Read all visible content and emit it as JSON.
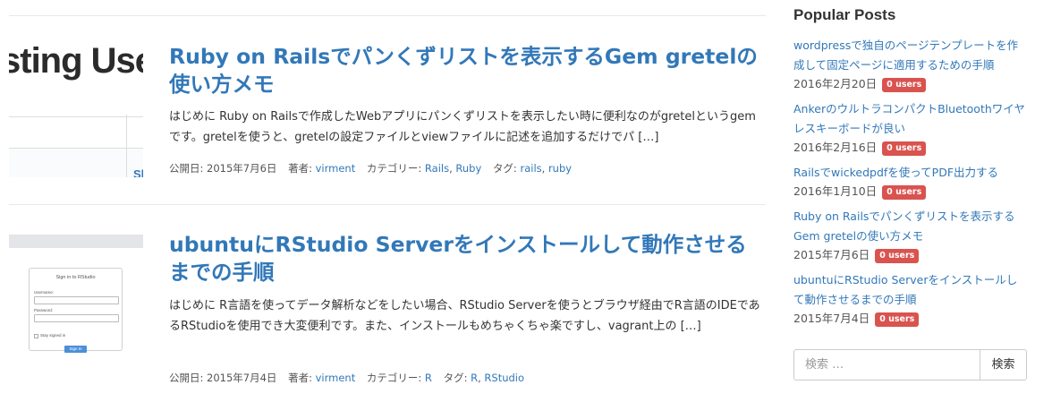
{
  "posts": [
    {
      "thumb_text": "sting User",
      "thumb_link_text": "Sh",
      "title": "Ruby on Railsでパンくずリストを表示するGem gretelの使い方メモ",
      "excerpt": "はじめに Ruby on Railsで作成したWebアプリにパンくずリストを表示したい時に便利なのがgretelというgemです。gretelを使うと、gretelの設定ファイルとviewファイルに記述を追加するだけでパ […]",
      "meta": {
        "date_label": "公開日: 2015年7月6日",
        "author_label": "著者:",
        "author": "virment",
        "category_label": "カテゴリー:",
        "categories": [
          "Rails",
          "Ruby"
        ],
        "tag_label": "タグ:",
        "tags": [
          "rails",
          "ruby"
        ]
      }
    },
    {
      "thumb_form": {
        "title": "Sign in to RStudio",
        "username_label": "Username:",
        "password_label": "Password:",
        "stay_label": "Stay signed in",
        "button": "Sign In"
      },
      "title": "ubuntuにRStudio Serverをインストールして動作させるまでの手順",
      "excerpt": "はじめに R言語を使ってデータ解析などをしたい場合、RStudio Serverを使うとブラウザ経由でR言語のIDEであるRStudioを使用でき大変便利です。また、インストールもめちゃくちゃ楽ですし、vagrant上の […]",
      "meta": {
        "date_label": "公開日: 2015年7月4日",
        "author_label": "著者:",
        "author": "virment",
        "category_label": "カテゴリー:",
        "categories": [
          "R"
        ],
        "tag_label": "タグ:",
        "tags": [
          "R",
          "RStudio"
        ]
      }
    }
  ],
  "sidebar": {
    "title": "Popular Posts",
    "items": [
      {
        "title": "wordpressで独自のページテンプレートを作成して固定ページに適用するための手順",
        "date": "2016年2月20日",
        "badge": "0 users"
      },
      {
        "title": "AnkerのウルトラコンパクトBluetoothワイヤレスキーボードが良い",
        "date": "2016年2月16日",
        "badge": "0 users"
      },
      {
        "title": "Railsでwickedpdfを使ってPDF出力する",
        "date": "2016年1月10日",
        "badge": "0 users"
      },
      {
        "title": "Ruby on Railsでパンくずリストを表示するGem gretelの使い方メモ",
        "date": "2015年7月6日",
        "badge": "0 users"
      },
      {
        "title": "ubuntuにRStudio Serverをインストールして動作させるまでの手順",
        "date": "2015年7月4日",
        "badge": "0 users"
      }
    ],
    "search": {
      "placeholder": "検索 …",
      "button": "検索"
    }
  },
  "colors": {
    "link": "#3278b8",
    "badge": "#d9534f"
  }
}
